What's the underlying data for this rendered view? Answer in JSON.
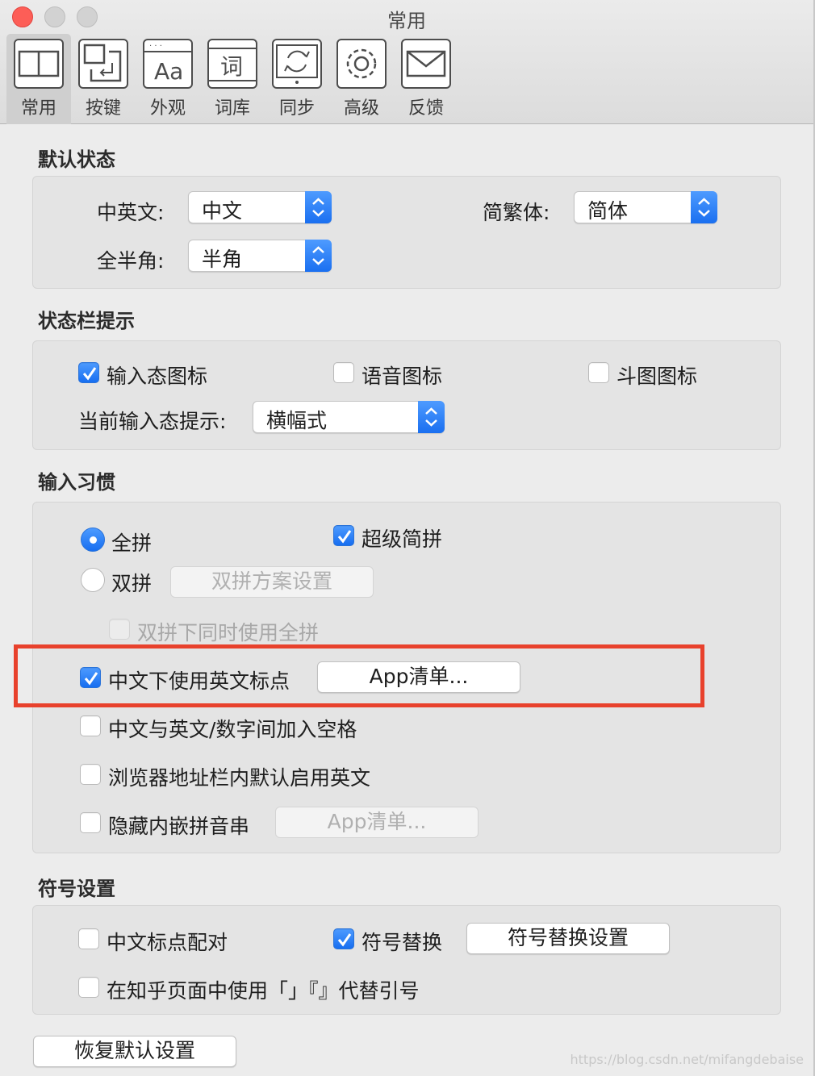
{
  "window": {
    "title": "常用"
  },
  "toolbar": {
    "items": [
      {
        "label": "常用",
        "icon": "general-icon"
      },
      {
        "label": "按键",
        "icon": "keys-icon"
      },
      {
        "label": "外观",
        "icon": "appearance-icon"
      },
      {
        "label": "词库",
        "icon": "dictionary-icon"
      },
      {
        "label": "同步",
        "icon": "sync-icon"
      },
      {
        "label": "高级",
        "icon": "gear-icon"
      },
      {
        "label": "反馈",
        "icon": "envelope-icon"
      }
    ],
    "dictionary_glyph": "词",
    "appearance_glyph": "Aa"
  },
  "default_state": {
    "title": "默认状态",
    "zh_en_label": "中英文:",
    "zh_en_value": "中文",
    "simp_trad_label": "简繁体:",
    "simp_trad_value": "简体",
    "width_label": "全半角:",
    "width_value": "半角"
  },
  "status_bar": {
    "title": "状态栏提示",
    "input_state_icon": "输入态图标",
    "voice_icon": "语音图标",
    "doutu_icon": "斗图图标",
    "current_hint_label": "当前输入态提示:",
    "current_hint_value": "横幅式"
  },
  "input_habit": {
    "title": "输入习惯",
    "full_pinyin": "全拼",
    "super_jianpin": "超级简拼",
    "double_pinyin": "双拼",
    "double_pinyin_settings": "双拼方案设置",
    "double_with_full": "双拼下同时使用全拼",
    "english_punct": "中文下使用英文标点",
    "app_list_1": "App清单...",
    "space_between": "中文与英文/数字间加入空格",
    "browser_english": "浏览器地址栏内默认启用英文",
    "hide_inline": "隐藏内嵌拼音串",
    "app_list_2": "App清单..."
  },
  "symbols": {
    "title": "符号设置",
    "punct_pair": "中文标点配对",
    "symbol_replace": "符号替换",
    "symbol_replace_settings": "符号替换设置",
    "zhihu_quotes": "在知乎页面中使用「」『』代替引号"
  },
  "restore_defaults": "恢复默认设置",
  "watermark": "https://blog.csdn.net/mifangdebaise",
  "colors": {
    "accent": "#1a6ff0",
    "highlight_box": "#e8412c"
  }
}
